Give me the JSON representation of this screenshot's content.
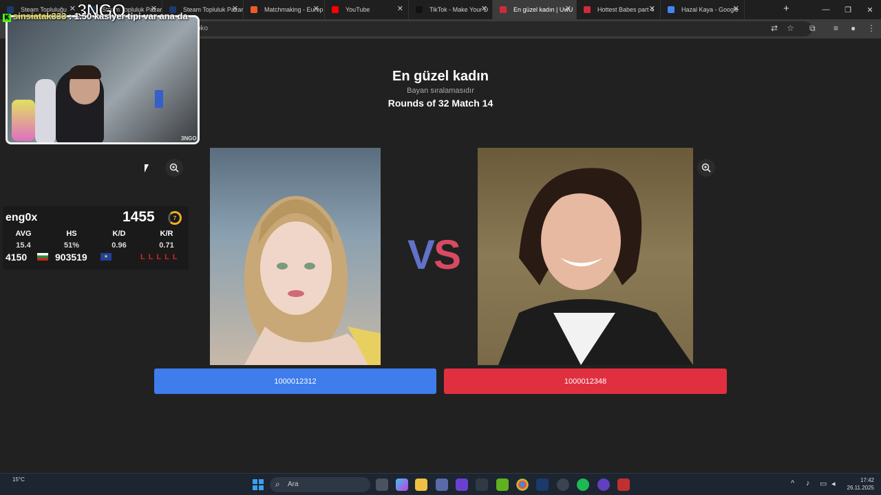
{
  "browser": {
    "tabs": [
      {
        "label": "Steam Topluluğu",
        "fav_color": "#1b3a6b"
      },
      {
        "label": "Steam Topluluk Pazarı",
        "fav_color": "#1b3a6b"
      },
      {
        "label": "Steam Topluluk Pazar",
        "fav_color": "#1b3a6b"
      },
      {
        "label": "Matchmaking - Europ",
        "fav_color": "#f05a28"
      },
      {
        "label": "YouTube",
        "fav_color": "#ff0000"
      },
      {
        "label": "TikTok - Make Your D",
        "fav_color": "#111111"
      },
      {
        "label": "En güzel kadın | UwU",
        "fav_color": "#d02a3a"
      },
      {
        "label": "Hottest Babes part 4",
        "fav_color": "#d02a3a"
      },
      {
        "label": "Hazal Kaya - Google",
        "fav_color": "#4285f4"
      }
    ],
    "active_tab": 6,
    "address": "oko",
    "new_tab": "+",
    "win_minimize": "—",
    "win_maximize": "❐",
    "win_close": "✕"
  },
  "page": {
    "title": "En güzel kadın",
    "subtitle": "Bayan sıralamasıdır",
    "round": "Rounds of 32 Match 14",
    "vs_v": "V",
    "vs_s": "S",
    "left_button": "1000012312",
    "right_button": "1000012348"
  },
  "overlay": {
    "logo": "3NGO",
    "webcam_badge": "3NGO",
    "stats": {
      "name": "eng0x",
      "elo": "1455",
      "level": "7",
      "headers": [
        "AVG",
        "HS",
        "K/D",
        "K/R"
      ],
      "values": [
        "15.4",
        "51%",
        "0.96",
        "0.71"
      ],
      "position": "4150",
      "eu_position": "903519",
      "eu_flag": "★",
      "recent": "LLLLL"
    }
  },
  "taskbar": {
    "temperature": "15°C",
    "chat_user": "sinsiatak333",
    "chat_message": ": 1.50 kasiyer tipi var ana da",
    "chat_platform": "K",
    "search_placeholder": "Ara",
    "time": "17:42",
    "date": "26.11.2025"
  }
}
